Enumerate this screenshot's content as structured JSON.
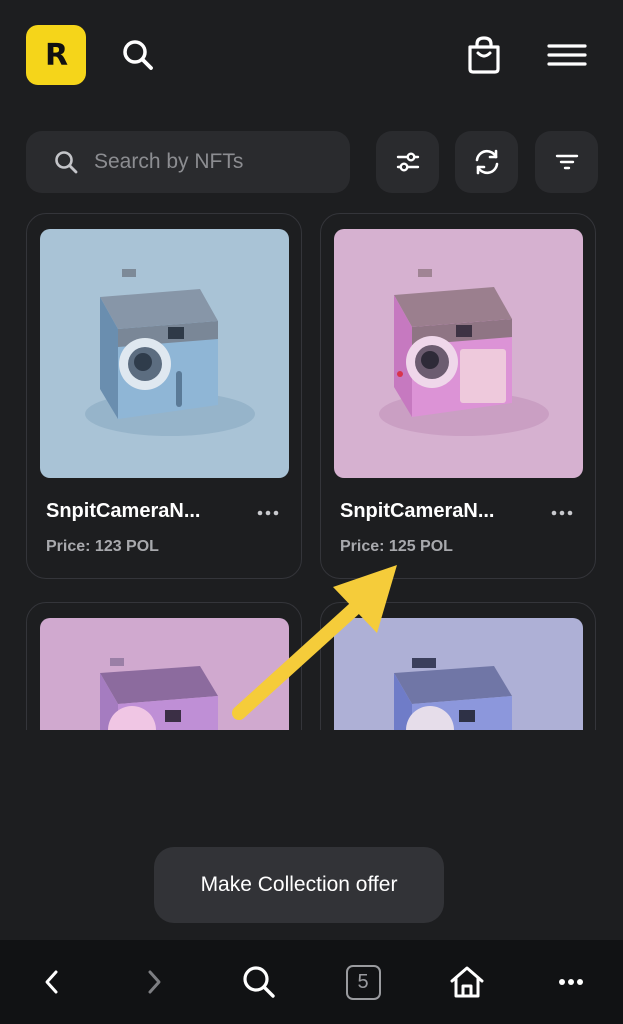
{
  "header": {
    "logo_text": "R",
    "icons": [
      "search-icon",
      "shopping-bag-icon",
      "hamburger-menu-icon"
    ],
    "brand_color": "#f5d51a"
  },
  "search": {
    "placeholder": "Search by NFTs",
    "value": ""
  },
  "toolbar": {
    "buttons": [
      "sliders-icon",
      "refresh-icon",
      "filter-icon"
    ]
  },
  "cards": [
    {
      "name": "SnpitCameraN...",
      "price": "Price: 123 POL",
      "image": "blue-camera"
    },
    {
      "name": "SnpitCameraN...",
      "price": "Price: 125 POL",
      "image": "pink-camera"
    },
    {
      "name": "",
      "price": "",
      "image": "purple-camera"
    },
    {
      "name": "",
      "price": "",
      "image": "lavender-camera"
    }
  ],
  "annotation": {
    "type": "arrow",
    "color": "#f5cc3a"
  },
  "offer_button": {
    "label": "Make Collection offer"
  },
  "browser_nav": {
    "tab_count": "5",
    "icons": [
      "back-icon",
      "forward-icon",
      "search-icon",
      "tabs-icon",
      "home-icon",
      "more-icon"
    ]
  }
}
